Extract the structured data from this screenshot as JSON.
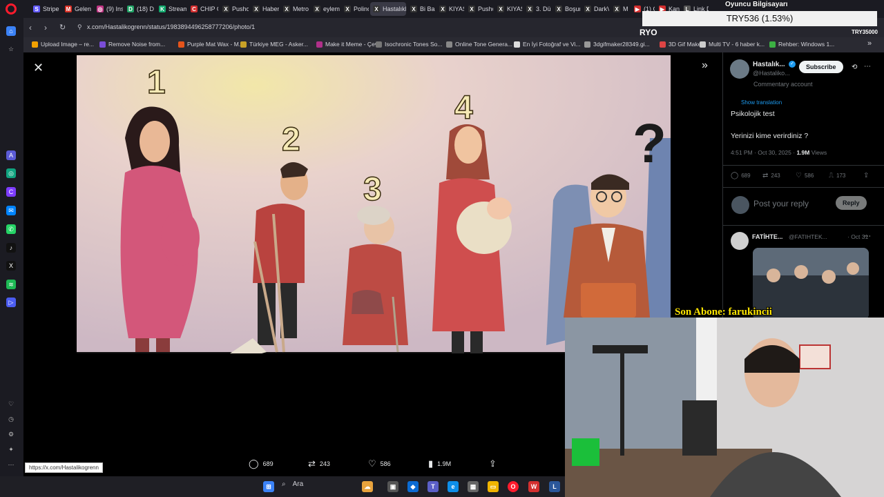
{
  "browser": {
    "tabs": [
      {
        "label": "Stripe",
        "color": "#635bff",
        "glyph": "S"
      },
      {
        "label": "Gelen",
        "color": "#d93025",
        "glyph": "M"
      },
      {
        "label": "(9) Ins",
        "color": "#c13584",
        "glyph": "◎"
      },
      {
        "label": "(18) D",
        "color": "#21a366",
        "glyph": "D"
      },
      {
        "label": "Stream",
        "color": "#11a86c",
        "glyph": "K"
      },
      {
        "label": "CHIP C",
        "color": "#d32f2f",
        "glyph": "C"
      },
      {
        "label": "Pusho",
        "color": "#333",
        "glyph": "X"
      },
      {
        "label": "Haber",
        "color": "#333",
        "glyph": "X"
      },
      {
        "label": "Metro",
        "color": "#333",
        "glyph": "X"
      },
      {
        "label": "eylem",
        "color": "#333",
        "glyph": "X"
      },
      {
        "label": "Polino",
        "color": "#333",
        "glyph": "X"
      },
      {
        "label": "HastalıkNe",
        "color": "#333",
        "glyph": "X"
      },
      {
        "label": "Bi Bak",
        "color": "#333",
        "glyph": "X"
      },
      {
        "label": "KIYAS",
        "color": "#333",
        "glyph": "X"
      },
      {
        "label": "Pusho",
        "color": "#333",
        "glyph": "X"
      },
      {
        "label": "KIYAS",
        "color": "#333",
        "glyph": "X"
      },
      {
        "label": "3. Dün",
        "color": "#333",
        "glyph": "X"
      },
      {
        "label": "Boşun",
        "color": "#333",
        "glyph": "X"
      },
      {
        "label": "DarkV",
        "color": "#333",
        "glyph": "X"
      },
      {
        "label": "M",
        "color": "#333",
        "glyph": "X"
      },
      {
        "label": "(1) Ci",
        "color": "#d32f2f",
        "glyph": "▶"
      },
      {
        "label": "Kanal",
        "color": "#d32f2f",
        "glyph": "▶"
      },
      {
        "label": "Link D",
        "color": "#555",
        "glyph": "L"
      }
    ],
    "url": "x.com/Hastalikogrenn/status/1983894496258777206/photo/1",
    "bookmarks": [
      {
        "label": "Upload Image – re...",
        "color": "#f2a100"
      },
      {
        "label": "Remove Noise from...",
        "color": "#7a4dd8"
      },
      {
        "label": "Purple Mat Wax - M...",
        "color": "#e6541b"
      },
      {
        "label": "Türkiye MEG - Asker...",
        "color": "#c9a227"
      },
      {
        "label": "Make it Meme - Çev...",
        "color": "#b0308a"
      },
      {
        "label": "Isochronic Tones So...",
        "color": "#777"
      },
      {
        "label": "Online Tone Genera...",
        "color": "#888"
      },
      {
        "label": "En İyi Fotoğraf ve Vi...",
        "color": "#ddd"
      },
      {
        "label": "3dgifmaker28349.gi...",
        "color": "#999"
      },
      {
        "label": "3D Gif Maker",
        "color": "#d44"
      },
      {
        "label": "Multi TV - 6 haber k...",
        "color": "#ccc"
      },
      {
        "label": "Rehber: Windows 1...",
        "color": "#3cb043"
      }
    ]
  },
  "viewer": {
    "numbers": [
      "1",
      "2",
      "3",
      "4",
      "?"
    ],
    "actions": {
      "replies": "689",
      "reposts": "243",
      "likes": "586",
      "views": "1.9M"
    },
    "status_url": "https://x.com/Hastalikogrenn"
  },
  "tweet": {
    "name": "Hastalık...",
    "handle": "@Hastaliko...",
    "subscribe": "Subscribe",
    "community": "Commentary account",
    "show_translation": "Show translation",
    "text_line1": "Psikolojik test",
    "text_line2": "Yerinizi kime verirdiniz ?",
    "time": "4:51 PM · Oct 30, 2025 · ",
    "views_count": "1.9M",
    "views_label": " Views",
    "stats": {
      "replies": "689",
      "reposts": "243",
      "likes": "586",
      "bookmarks": "173"
    },
    "reply_placeholder": "Post your reply",
    "reply_button": "Reply",
    "reply_user": {
      "name": "FATİHTE...",
      "handle": "@FATIHTEK...",
      "date": "· Oct 31"
    }
  },
  "overlay": {
    "title": "Oyuncu Bilgisayarı",
    "ticker": "TRY536 (1.53%)",
    "left_code": "RYO",
    "right_code": "TRY35000",
    "subscriber": "Son Abone: farukincii"
  },
  "taskbar": {
    "search": "Ara"
  }
}
